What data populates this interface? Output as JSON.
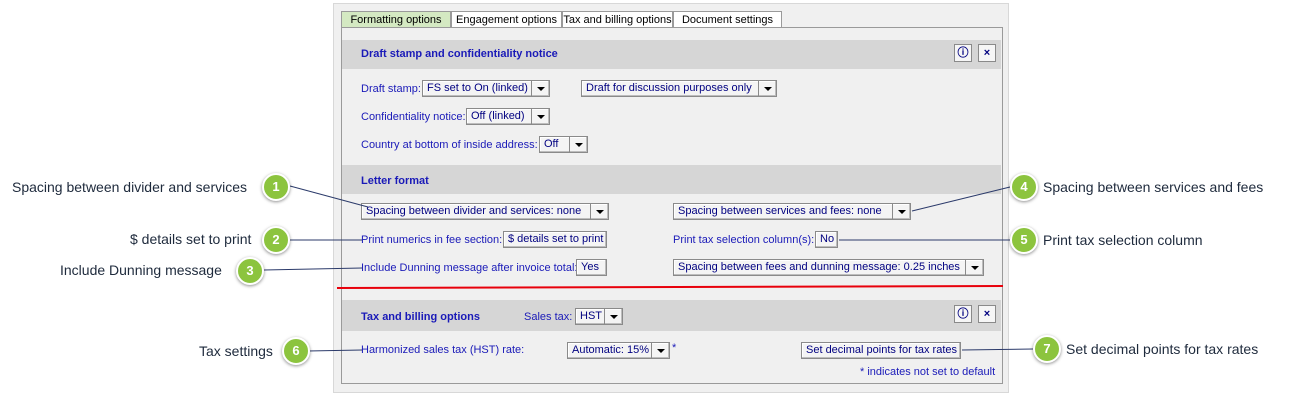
{
  "tabs": [
    "Formatting options",
    "Engagement options",
    "Tax and billing options",
    "Document settings"
  ],
  "draft_section": {
    "title": "Draft stamp and confidentiality notice",
    "draft_stamp_label": "Draft stamp:",
    "draft_stamp_value": "FS set to On (linked)",
    "draft_text_value": "Draft for discussion purposes only",
    "confidentiality_label": "Confidentiality notice:",
    "confidentiality_value": "Off (linked)",
    "country_label": "Country at bottom of inside address:",
    "country_value": "Off"
  },
  "letter_section": {
    "title": "Letter format",
    "divider_spacing_value": "Spacing between divider and services: none",
    "services_fees_spacing_value": "Spacing between services and fees: none",
    "print_numerics_label": "Print numerics in fee section:",
    "print_numerics_value": "$ details set to print",
    "print_tax_label": "Print tax selection column(s):",
    "print_tax_value": "No",
    "dunning_label": "Include Dunning message after invoice total:",
    "dunning_value": "Yes",
    "fees_dunning_spacing_value": "Spacing between fees and dunning message: 0.25 inches"
  },
  "tax_section": {
    "title": "Tax and billing options",
    "sales_tax_label": "Sales tax:",
    "sales_tax_value": "HST",
    "hst_label": "Harmonized sales tax (HST) rate:",
    "hst_value": "Automatic: 15%",
    "asterisk": "*",
    "decimal_button": "Set decimal points for tax rates",
    "footnote": "* indicates not set to default"
  },
  "icons": {
    "info": "info-icon",
    "close": "close-icon"
  },
  "info_glyph": "ⓘ",
  "close_glyph": "×",
  "callouts": [
    {
      "num": "1",
      "text": "Spacing between divider and services"
    },
    {
      "num": "2",
      "text": "$ details set to print"
    },
    {
      "num": "3",
      "text": "Include Dunning message"
    },
    {
      "num": "4",
      "text": "Spacing between services and fees"
    },
    {
      "num": "5",
      "text": "Print tax selection column"
    },
    {
      "num": "6",
      "text": "Tax settings"
    },
    {
      "num": "7",
      "text": "Set decimal points for tax rates"
    }
  ],
  "colors": {
    "accent_text": "#1a1ab8",
    "badge": "#8cc43e",
    "divider_red": "#e8000b"
  }
}
